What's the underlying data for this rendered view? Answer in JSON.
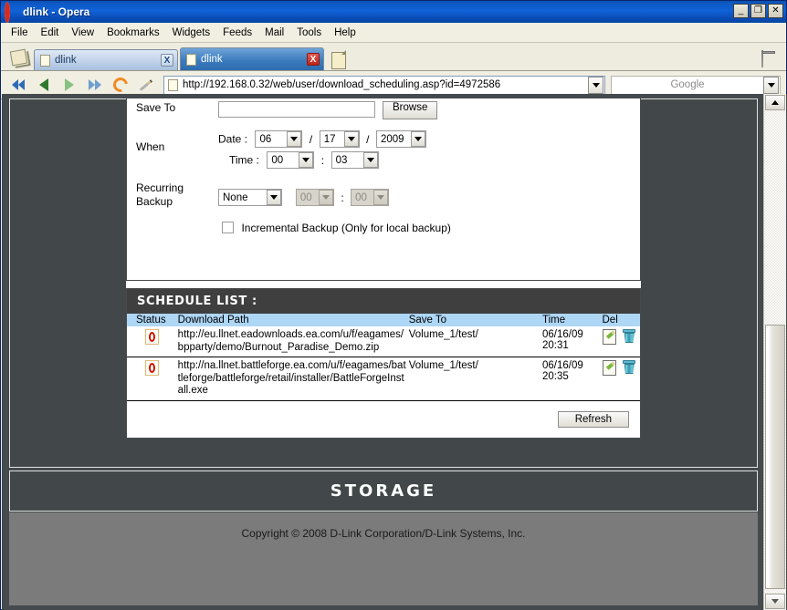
{
  "window": {
    "title": "dlink - Opera",
    "minimize_label": "_",
    "maximize_label": "❐",
    "close_label": "✕"
  },
  "menubar": {
    "items": [
      "File",
      "Edit",
      "View",
      "Bookmarks",
      "Widgets",
      "Feeds",
      "Mail",
      "Tools",
      "Help"
    ]
  },
  "tabs": [
    {
      "label": "dlink",
      "close_label": "X",
      "active": false
    },
    {
      "label": "dlink",
      "close_label": "X",
      "active": true
    }
  ],
  "navbar": {
    "url": "http://192.168.0.32/web/user/download_scheduling.asp?id=4972586",
    "search_placeholder": "Google"
  },
  "page": {
    "form": {
      "save_to": {
        "label": "Save To",
        "value": "",
        "browse_label": "Browse"
      },
      "when": {
        "label": "When",
        "date_label": "Date :",
        "date_month": "06",
        "date_day": "17",
        "date_year": "2009",
        "time_label": "Time :",
        "time_hour": "00",
        "time_minute": "03",
        "date_sep": "/",
        "time_sep": ":"
      },
      "recurring": {
        "label": "Recurring Backup",
        "mode": "None",
        "hour": "00",
        "minute": "00",
        "sep": ":"
      },
      "incremental": {
        "label": "Incremental Backup (Only for local backup)",
        "checked": false
      }
    },
    "schedule_list": {
      "title": "SCHEDULE LIST :",
      "columns": [
        "Status",
        "Download Path",
        "Save To",
        "Time",
        "Del"
      ],
      "rows": [
        {
          "status": "pending",
          "path": "http://eu.llnet.eadownloads.ea.com/u/f/eagames/bpparty/demo/Burnout_Paradise_Demo.zip",
          "save_to": "Volume_1/test/",
          "time": "06/16/09 20:31"
        },
        {
          "status": "pending",
          "path": "http://na.llnet.battleforge.ea.com/u/f/eagames/battleforge/battleforge/retail/installer/BattleForgeInstall.exe",
          "save_to": "Volume_1/test/",
          "time": "06/16/09 20:35"
        }
      ],
      "refresh_label": "Refresh"
    },
    "storage_banner": "STORAGE",
    "copyright": "Copyright © 2008 D-Link Corporation/D-Link Systems, Inc."
  },
  "colors": {
    "titlebar": "#0d58c4",
    "panel_dark": "#424849",
    "table_header": "#aed6f5",
    "footer_gray": "#7b7b7b"
  }
}
